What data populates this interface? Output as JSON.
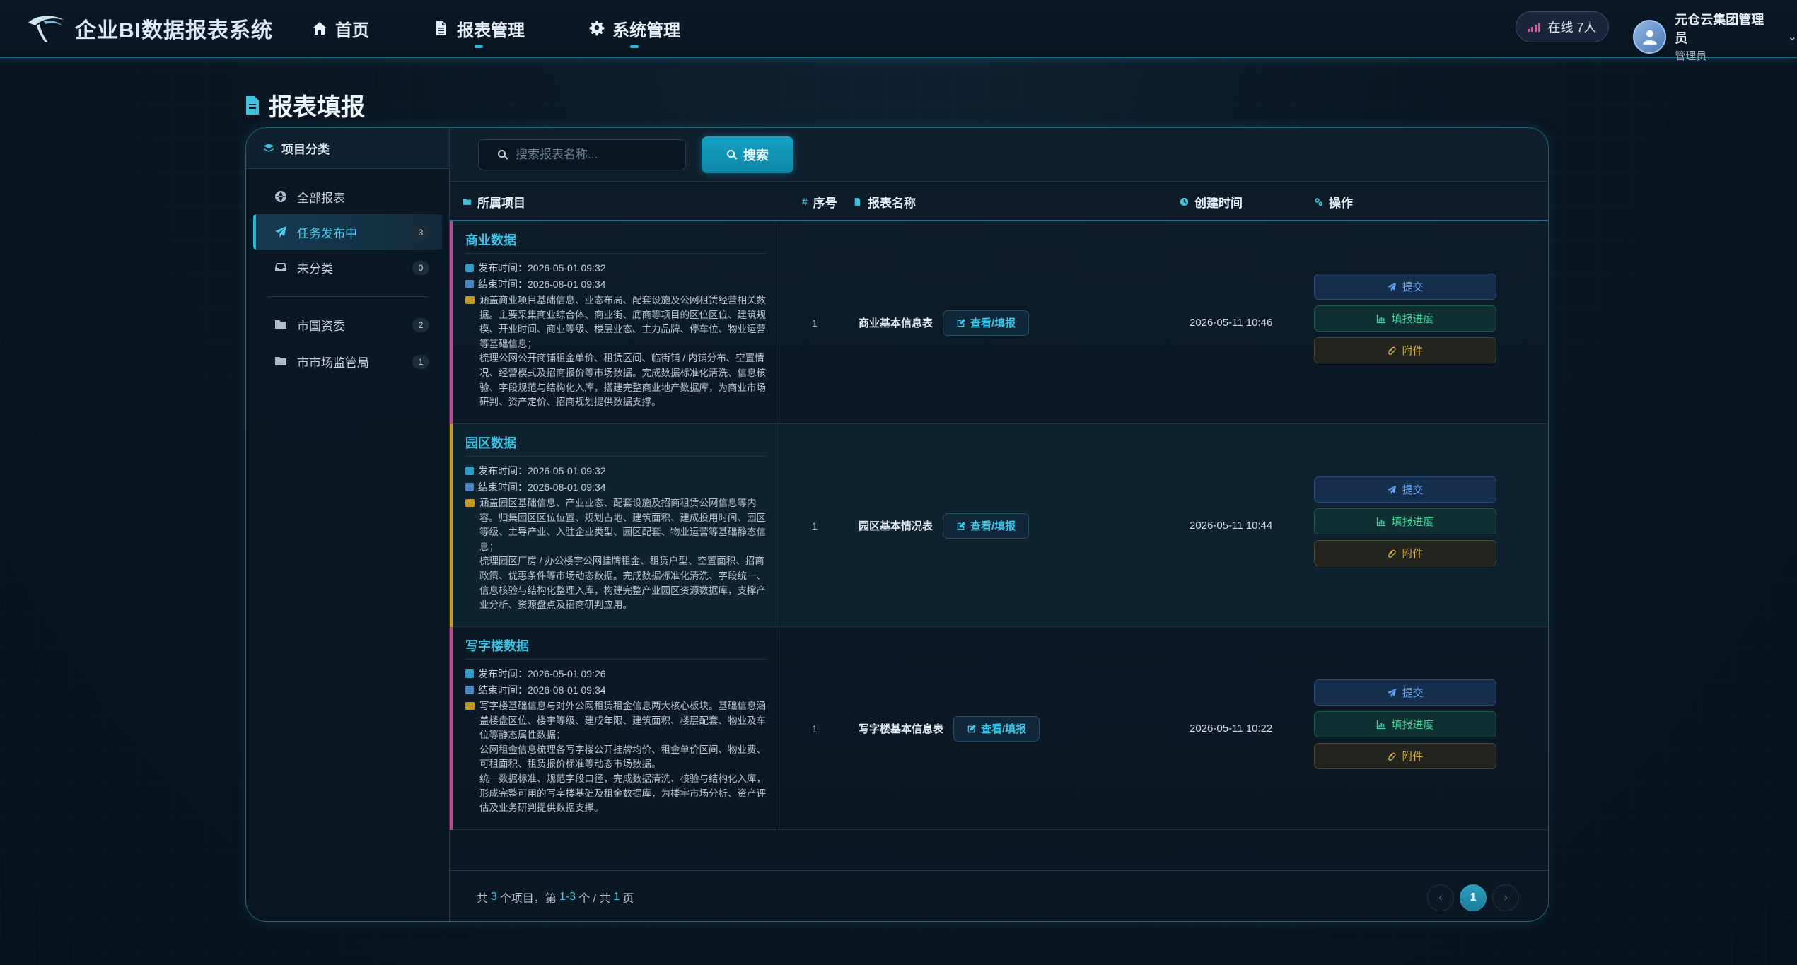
{
  "app": {
    "title": "企业BI数据报表系统"
  },
  "nav": {
    "items": [
      {
        "label": "首页",
        "icon": "home-icon"
      },
      {
        "label": "报表管理",
        "icon": "file-icon"
      },
      {
        "label": "系统管理",
        "icon": "gear-icon"
      }
    ]
  },
  "header": {
    "online": "在线 7人",
    "user_name": "元仓云集团管理员",
    "user_role": "管理员"
  },
  "page": {
    "title": "报表填报"
  },
  "sidebar": {
    "title": "项目分类",
    "items": [
      {
        "label": "全部报表",
        "count": "",
        "icon": "globe-icon"
      },
      {
        "label": "任务发布中",
        "count": "3",
        "icon": "send-icon"
      },
      {
        "label": "未分类",
        "count": "0",
        "icon": "inbox-icon"
      },
      {
        "label": "市国资委",
        "count": "2",
        "icon": "folder-icon"
      },
      {
        "label": "市市场监管局",
        "count": "1",
        "icon": "folder-icon"
      }
    ]
  },
  "search": {
    "placeholder": "搜索报表名称...",
    "button": "搜索"
  },
  "table": {
    "headers": {
      "project": "所属项目",
      "seq": "序号",
      "name": "报表名称",
      "created": "创建时间",
      "actions": "操作"
    },
    "view_label": "查看/填报",
    "action_labels": {
      "submit": "提交",
      "progress": "填报进度",
      "attach": "附件"
    },
    "rows": [
      {
        "project": "商业数据",
        "publish": "发布时间：2026-05-01 09:32",
        "end": "结束时间：2026-08-01 09:34",
        "desc1": "涵盖商业项目基础信息、业态布局、配套设施及公网租赁经营相关数据。主要采集商业综合体、商业街、底商等项目的区位区位、建筑规模、开业时间、商业等级、楼层业态、主力品牌、停车位、物业运营等基础信息；",
        "desc2": "梳理公网公开商铺租金单价、租赁区间、临街铺 / 内铺分布、空置情况、经营模式及招商报价等市场数据。完成数据标准化清洗、信息核验、字段规范与结构化入库，搭建完整商业地产数据库，为商业市场研判、资产定价、招商规划提供数据支撑。",
        "seq": "1",
        "name": "商业基本信息表",
        "created": "2026-05-11 10:46"
      },
      {
        "project": "园区数据",
        "publish": "发布时间：2026-05-01 09:32",
        "end": "结束时间：2026-08-01 09:34",
        "desc1": "涵盖园区基础信息、产业业态、配套设施及招商租赁公网信息等内容。归集园区区位位置、规划占地、建筑面积、建成投用时间、园区等级、主导产业、入驻企业类型、园区配套、物业运营等基础静态信息；",
        "desc2": "梳理园区厂房 / 办公楼宇公网挂牌租金、租赁户型、空置面积、招商政策、优惠条件等市场动态数据。完成数据标准化清洗、字段统一、信息核验与结构化整理入库，构建完整产业园区资源数据库，支撑产业分析、资源盘点及招商研判应用。",
        "seq": "1",
        "name": "园区基本情况表",
        "created": "2026-05-11 10:44"
      },
      {
        "project": "写字楼数据",
        "publish": "发布时间：2026-05-01 09:26",
        "end": "结束时间：2026-08-01 09:34",
        "desc1": "写字楼基础信息与对外公网租赁租金信息两大核心板块。基础信息涵盖楼盘区位、楼宇等级、建成年限、建筑面积、楼层配套、物业及车位等静态属性数据；",
        "desc2": "公网租金信息梳理各写字楼公开挂牌均价、租金单价区间、物业费、可租面积、租赁报价标准等动态市场数据。",
        "desc3": "统一数据标准、规范字段口径，完成数据清洗、核验与结构化入库，形成完整可用的写字楼基础及租金数据库，为楼宇市场分析、资产评估及业务研判提供数据支撑。",
        "seq": "1",
        "name": "写字楼基本信息表",
        "created": "2026-05-11 10:22"
      }
    ]
  },
  "pagination": {
    "p1": "共",
    "total": "3",
    "p2": "个项目，第",
    "range": "1-3",
    "p3": "个 / 共",
    "pages": "1",
    "p4": "页",
    "current": "1",
    "prev": "‹",
    "next": "›"
  },
  "colors": {
    "accent": "#3fc0dd",
    "submit": "#63a3ef",
    "progress": "#3dd49b",
    "attach": "#d3b24e"
  }
}
